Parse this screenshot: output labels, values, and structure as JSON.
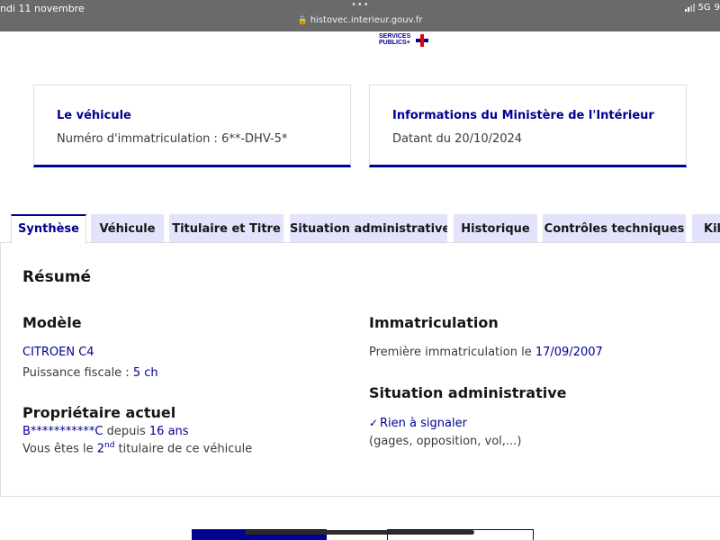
{
  "status_bar": {
    "time": "ndi 11 novembre",
    "dots": "•••",
    "url": "histovec.interieur.gouv.fr",
    "network": "5G",
    "battery": "9"
  },
  "logo": {
    "line1": "SERVICES",
    "line2": "PUBLICS+"
  },
  "cards": [
    {
      "title": "Le véhicule",
      "value": "Numéro d'immatriculation : 6**-DHV-5*"
    },
    {
      "title": "Informations du Ministère de l'Intérieur",
      "value": "Datant du 20/10/2024"
    }
  ],
  "tabs": [
    {
      "label": "Synthèse",
      "active": true
    },
    {
      "label": "Véhicule",
      "active": false
    },
    {
      "label": "Titulaire et Titre",
      "active": false
    },
    {
      "label": "Situation administrative",
      "active": false
    },
    {
      "label": "Historique",
      "active": false
    },
    {
      "label": "Contrôles techniques",
      "active": false
    },
    {
      "label": "Kilo",
      "active": false
    }
  ],
  "summary": {
    "heading": "Résumé",
    "model": {
      "heading": "Modèle",
      "name": "CITROEN C4",
      "power_label": "Puissance fiscale : ",
      "power_value": "5 ch"
    },
    "owner": {
      "heading": "Propriétaire actuel",
      "id": "B***********C",
      "since_label": " depuis ",
      "since_value": "16 ans",
      "rank_prefix": "Vous êtes le ",
      "rank_number": "2",
      "rank_suffix": "nd",
      "rank_end": " titulaire de ce véhicule"
    },
    "registration": {
      "heading": "Immatriculation",
      "first_label": "Première immatriculation le ",
      "first_date": "17/09/2007"
    },
    "admin": {
      "heading": "Situation administrative",
      "status": "Rien à signaler",
      "details": "(gages, opposition, vol,...)"
    }
  },
  "colors": {
    "primary": "#000091",
    "tab_bg": "#e3e3fd",
    "text": "#161616",
    "muted": "#3a3a3a"
  }
}
